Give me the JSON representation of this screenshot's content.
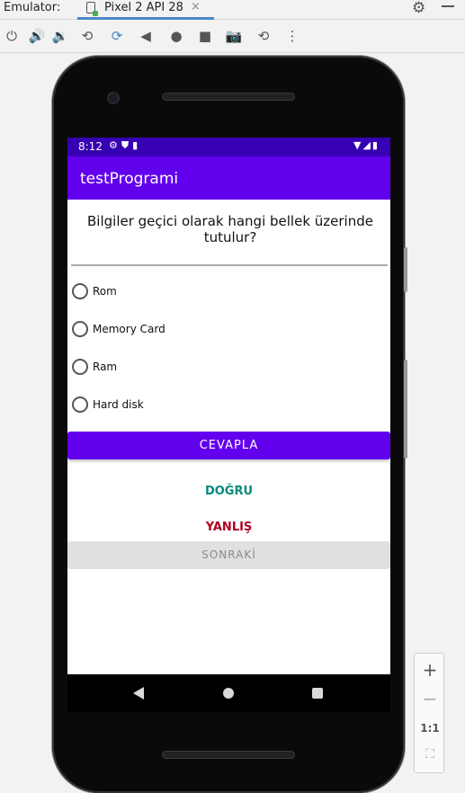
{
  "emulator": {
    "label": "Emulator:",
    "tab_title": "Pixel 2 API 28",
    "tab_close": "×"
  },
  "toolbar": {
    "icons": [
      "power-icon",
      "volume-up-icon",
      "volume-down-icon",
      "rotate-left-icon",
      "rotate-right-icon",
      "back-icon",
      "home-icon",
      "overview-icon",
      "camera-icon",
      "snapshot-icon",
      "more-icon"
    ]
  },
  "device": {
    "status": {
      "time": "8:12"
    },
    "app_title": "testProgrami",
    "question": "Bilgiler geçici olarak hangi bellek üzerinde tutulur?",
    "options": [
      "Rom",
      "Memory Card",
      "Ram",
      "Hard disk"
    ],
    "answer_button": "CEVAPLA",
    "correct_text": "DOĞRU",
    "wrong_text": "YANLIŞ",
    "next_button": "SONRAKİ"
  },
  "zoom_panel": {
    "plus": "+",
    "minus": "−",
    "actual_size": "1:1"
  },
  "colors": {
    "primary": "#6200ee",
    "primary_dark": "#3700b3",
    "correct": "#00897b",
    "wrong": "#b00020"
  }
}
